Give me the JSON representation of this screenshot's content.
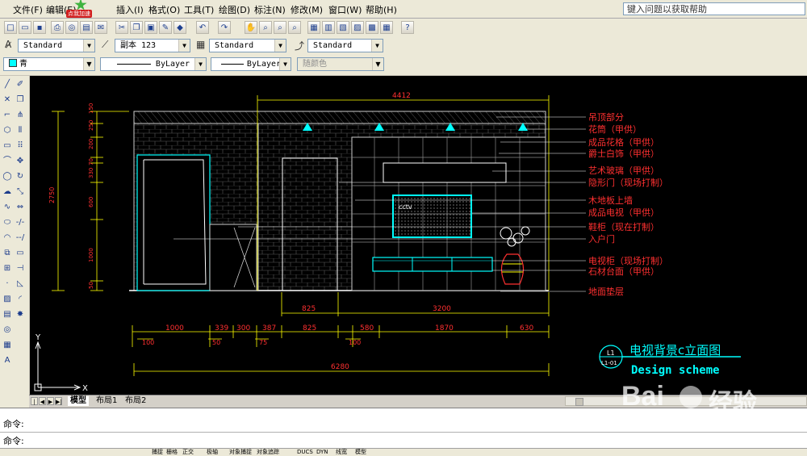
{
  "menubar": {
    "items": [
      "文件(F)",
      "编辑(E)",
      "插入(I)",
      "格式(O)",
      "工具(T)",
      "绘图(D)",
      "标注(N)",
      "修改(M)",
      "窗口(W)",
      "帮助(H)"
    ],
    "help_placeholder": "键入问题以获取帮助",
    "promo_label": "点我加速"
  },
  "styles_toolbar": {
    "text_style": "Standard",
    "dim_style": "副本 123",
    "table_style": "Standard",
    "multileader_style": "Standard"
  },
  "layers_toolbar": {
    "color": "青",
    "linetype": "ByLayer",
    "lineweight": "ByLayer",
    "plotstyle": "随颜色"
  },
  "drawing": {
    "dims_top": [
      "4412"
    ],
    "dims_left_total": "2750",
    "dims_left_parts": [
      "150",
      "250",
      "200",
      "70",
      "330",
      "600",
      "1000",
      "50"
    ],
    "dims_bottom_row1": [
      "825",
      "3200"
    ],
    "dims_bottom_row2": [
      "1000",
      "339",
      "300",
      "387",
      "825",
      "580",
      "1870",
      "630"
    ],
    "dims_bottom_row3": [
      "100",
      "50",
      "75",
      "100"
    ],
    "dims_total": "6280",
    "tv_label": "cctv",
    "annotations": [
      "吊顶部分",
      "花筒（甲供）",
      "成品花格（甲供）",
      "爵士白饰（甲供）",
      "艺术玻璃（甲供）",
      "隐形门（现场打制）",
      "木地板上墙",
      "成品电视（甲供）",
      "鞋柜（现在打制）",
      "入户门",
      "电视柜（现场打制）",
      "石材台面（甲供）",
      "地面垫层"
    ],
    "title_cn": "电视背景c立面图",
    "title_en": "Design scheme",
    "title_ref_top": "L1",
    "title_ref_bottom": "L1-01",
    "ucs_y": "Y",
    "ucs_x": "X",
    "colors": {
      "cyan": "#00ffff",
      "red": "#ff3030",
      "yellow": "#ffff00",
      "white": "#ffffff",
      "gray": "#888888"
    }
  },
  "tabs": {
    "items": [
      "模型",
      "布局1",
      "布局2"
    ]
  },
  "command": {
    "lines": [
      "命令:",
      "命令:"
    ]
  },
  "status": {
    "items": [
      "捕捉",
      "栅格",
      "正交",
      "极轴",
      "对象捕捉",
      "对象追踪",
      "DUCS",
      "DYN",
      "线宽",
      "模型"
    ]
  },
  "watermark": {
    "brand": "Bai",
    "brand_cn": "经验",
    "url": "jingyan.baidu.com"
  }
}
